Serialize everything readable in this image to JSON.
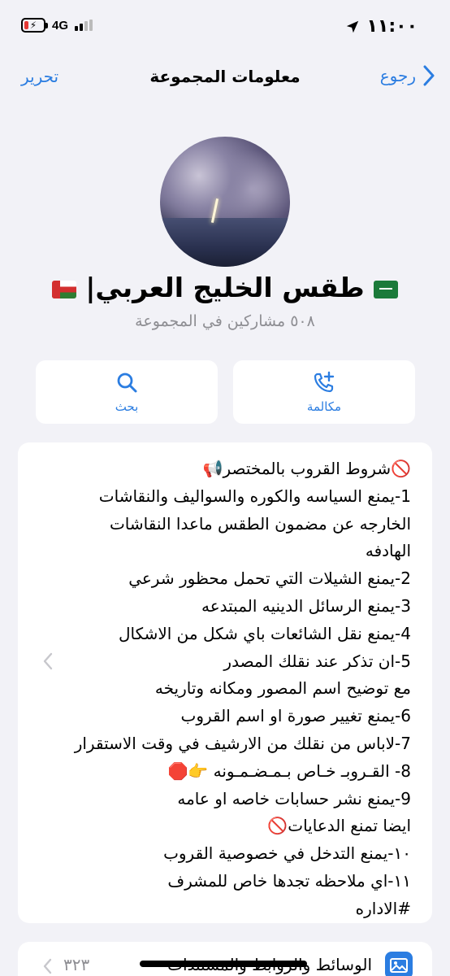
{
  "status_bar": {
    "time": "١١:٠٠",
    "network": "4G",
    "battery_icon": "battery-charging-icon",
    "location_icon": "location-arrow-icon"
  },
  "nav": {
    "edit_label": "تحرير",
    "title": "معلومات المجموعة",
    "back_label": "رجوع"
  },
  "group": {
    "name": "طقس الخليج العربي|",
    "members": "٥٠٨ مشاركين في المجموعة"
  },
  "actions": {
    "search_label": "بحث",
    "call_label": "مكالمة"
  },
  "description": {
    "lines": [
      "🚫شروط القروب بالمختصر📢",
      "1-يمنع السياسه والكوره والسواليف والنقاشات",
      "الخارجه عن مضمون الطقس ماعدا النقاشات",
      "الهادفه",
      "2-يمنع الشيلات التي تحمل محظور شرعي",
      "3-يمنع الرسائل الدينيه المبتدعه",
      "4-يمنع نقل الشائعات باي شكل من الاشكال",
      "5-ان تذكر عند نقلك المصدر",
      "مع توضيح اسم المصور ومكانه وتاريخه",
      "6-يمنع تغيير صورة او اسم القروب",
      "7-لاباس من نقلك من الارشيف في وقت الاستقرار",
      "8- القـروبـ خـاص بـمـضـمـونه 👉🛑",
      "9-يمنع نشر حسابات خاصه او عامه",
      "ايضا تمنع الدعايات🚫",
      "١٠-يمنع التدخل في خصوصية القروب",
      "١١-اي ملاحظه تجدها خاص للمشرف",
      "#الاداره"
    ]
  },
  "media": {
    "label": "الوسائط والروابط والمستندات",
    "count": "٣٢٣"
  },
  "colors": {
    "accent": "#2b7de1",
    "background": "#f2f2f7",
    "secondary_text": "#8e8e93"
  }
}
